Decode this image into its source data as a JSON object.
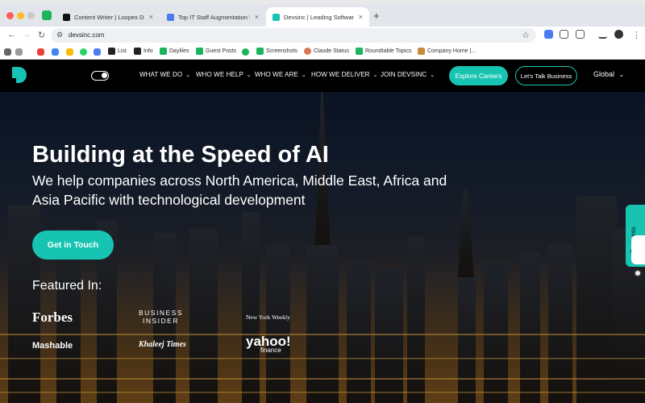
{
  "browser": {
    "tabs": [
      {
        "title": "Content Writer | Loopex Digi...",
        "active": false
      },
      {
        "title": "Top IT Staff Augmentation Fi...",
        "active": false
      },
      {
        "title": "Devsinc | Leading Software &...",
        "active": true
      }
    ],
    "new_tab_label": "+",
    "url": "devsinc.com",
    "bookmarks": [
      {
        "label": "List",
        "icon": "doc-icon"
      },
      {
        "label": "Info",
        "icon": "doc-icon"
      },
      {
        "label": "Dayliles",
        "icon": "sheet-icon"
      },
      {
        "label": "Guest Posts",
        "icon": "sheet-icon"
      },
      {
        "label": "Screenshots",
        "icon": "sheet-icon"
      },
      {
        "label": "Claude Status",
        "icon": "claude-icon"
      },
      {
        "label": "Roundtable Topics",
        "icon": "sheet-icon"
      },
      {
        "label": "Company Home |...",
        "icon": "home-icon"
      }
    ]
  },
  "site": {
    "nav": [
      {
        "label": "WHAT WE DO"
      },
      {
        "label": "WHO WE HELP"
      },
      {
        "label": "WHO WE ARE"
      },
      {
        "label": "HOW WE DELIVER"
      },
      {
        "label": "JOIN DEVSINC"
      }
    ],
    "explore_label": "Explore Careers",
    "talk_label": "Let's Talk Business",
    "region_label": "Global",
    "hero": {
      "title": "Building at the Speed of AI",
      "subtitle": "We help companies across North America, Middle East, Africa and Asia Pacific with technological development",
      "cta_label": "Get in Touch",
      "featured_label": "Featured In:"
    },
    "press": {
      "forbes": "Forbes",
      "business_insider_1": "BUSINESS",
      "business_insider_2": "INSIDER",
      "new_york_weekly": "New York Weekly",
      "mashable": "Mashable",
      "khaleej_times": "Khaleej Times",
      "yahoo": "yahoo!",
      "yahoo_sub": "finance"
    },
    "side_tab_label": "Business",
    "accent_color": "#17c4b2"
  }
}
